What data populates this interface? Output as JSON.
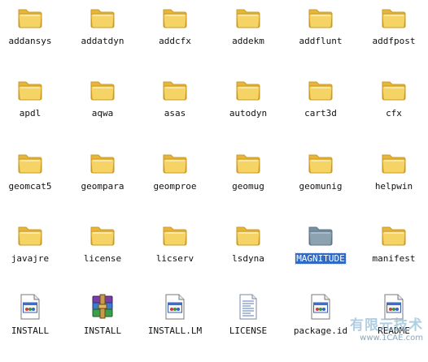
{
  "window": {
    "view": "icons",
    "selected_label": "MAGNITUDE"
  },
  "colors": {
    "folder_front": "#f6d365",
    "folder_back": "#e6b53a",
    "folder_outline": "#c99a25",
    "selected_folder": "#8ca2b1",
    "selection_bg": "#316ac5"
  },
  "items": [
    {
      "label": "addansys",
      "icon": "folder-icon"
    },
    {
      "label": "addatdyn",
      "icon": "folder-icon"
    },
    {
      "label": "addcfx",
      "icon": "folder-icon"
    },
    {
      "label": "addekm",
      "icon": "folder-icon"
    },
    {
      "label": "addflunt",
      "icon": "folder-icon"
    },
    {
      "label": "addfpost",
      "icon": "folder-icon"
    },
    {
      "label": "apdl",
      "icon": "folder-icon"
    },
    {
      "label": "aqwa",
      "icon": "folder-icon"
    },
    {
      "label": "asas",
      "icon": "folder-icon"
    },
    {
      "label": "autodyn",
      "icon": "folder-icon"
    },
    {
      "label": "cart3d",
      "icon": "folder-icon"
    },
    {
      "label": "cfx",
      "icon": "folder-icon"
    },
    {
      "label": "geomcat5",
      "icon": "folder-icon"
    },
    {
      "label": "geompara",
      "icon": "folder-icon"
    },
    {
      "label": "geomproe",
      "icon": "folder-icon"
    },
    {
      "label": "geomug",
      "icon": "folder-icon"
    },
    {
      "label": "geomunig",
      "icon": "folder-icon"
    },
    {
      "label": "helpwin",
      "icon": "folder-icon"
    },
    {
      "label": "javajre",
      "icon": "folder-icon"
    },
    {
      "label": "license",
      "icon": "folder-icon"
    },
    {
      "label": "licserv",
      "icon": "folder-icon"
    },
    {
      "label": "lsdyna",
      "icon": "folder-icon"
    },
    {
      "label": "MAGNITUDE",
      "icon": "folder-icon",
      "selected": true
    },
    {
      "label": "manifest",
      "icon": "folder-icon"
    },
    {
      "label": "INSTALL",
      "icon": "executable-icon"
    },
    {
      "label": "INSTALL",
      "icon": "winrar-archive-icon"
    },
    {
      "label": "INSTALL.LM",
      "icon": "executable-icon"
    },
    {
      "label": "LICENSE",
      "icon": "text-document-icon"
    },
    {
      "label": "package.id",
      "icon": "executable-icon"
    },
    {
      "label": "README",
      "icon": "executable-icon"
    }
  ],
  "watermark": {
    "line1": "有限元技术",
    "line2": "www.1CAE.com"
  }
}
